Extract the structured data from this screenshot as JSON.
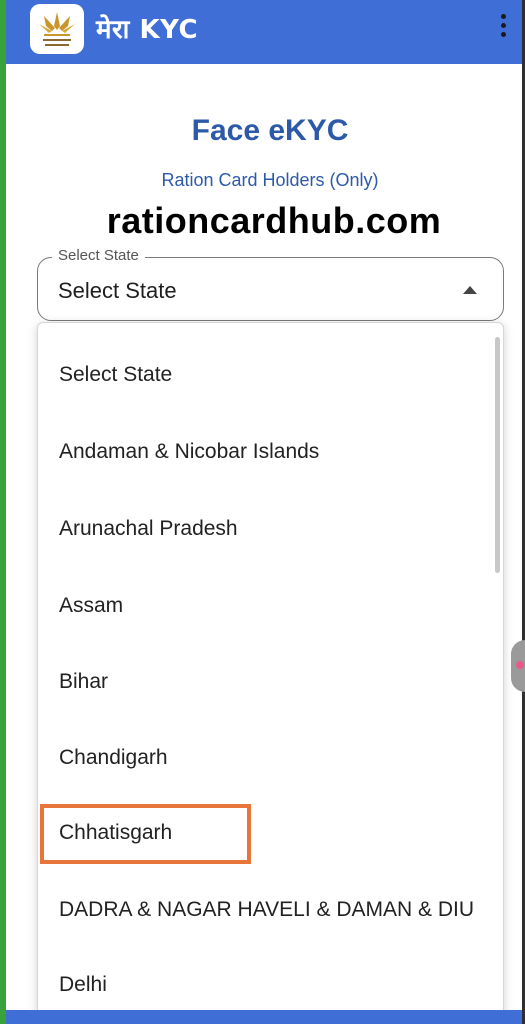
{
  "appbar": {
    "title": "मेरा KYC",
    "logo_icon": "emblem-logo-icon",
    "menu_icon": "kebab-menu-icon",
    "color": "#3f6fd6"
  },
  "page": {
    "title": "Face eKYC",
    "subtitle": "Ration Card Holders (Only)",
    "watermark": "rationcardhub.com"
  },
  "select": {
    "label": "Select State",
    "value": "Select State"
  },
  "dropdown": {
    "options": [
      "Select State",
      "Andaman & Nicobar Islands",
      "Arunachal Pradesh",
      "Assam",
      "Bihar",
      "Chandigarh",
      "Chhatisgarh",
      "DADRA & NAGAR HAVELI & DAMAN & DIU",
      "Delhi"
    ],
    "highlighted_option": "Chhatisgarh",
    "highlight_color": "#e8763a"
  }
}
